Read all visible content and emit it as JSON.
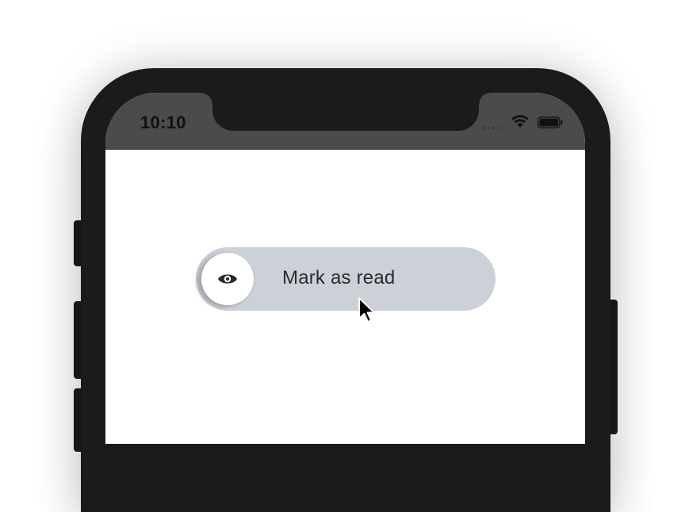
{
  "status_bar": {
    "time": "10:10"
  },
  "action": {
    "label": "Mark as read",
    "icon": "eye-icon"
  },
  "colors": {
    "frame": "#1b1b1b",
    "status_bar_bg": "#4b4b4b",
    "track_bg": "#ccd0d7",
    "knob_bg": "#ffffff",
    "label_color": "#2b2b2f"
  }
}
